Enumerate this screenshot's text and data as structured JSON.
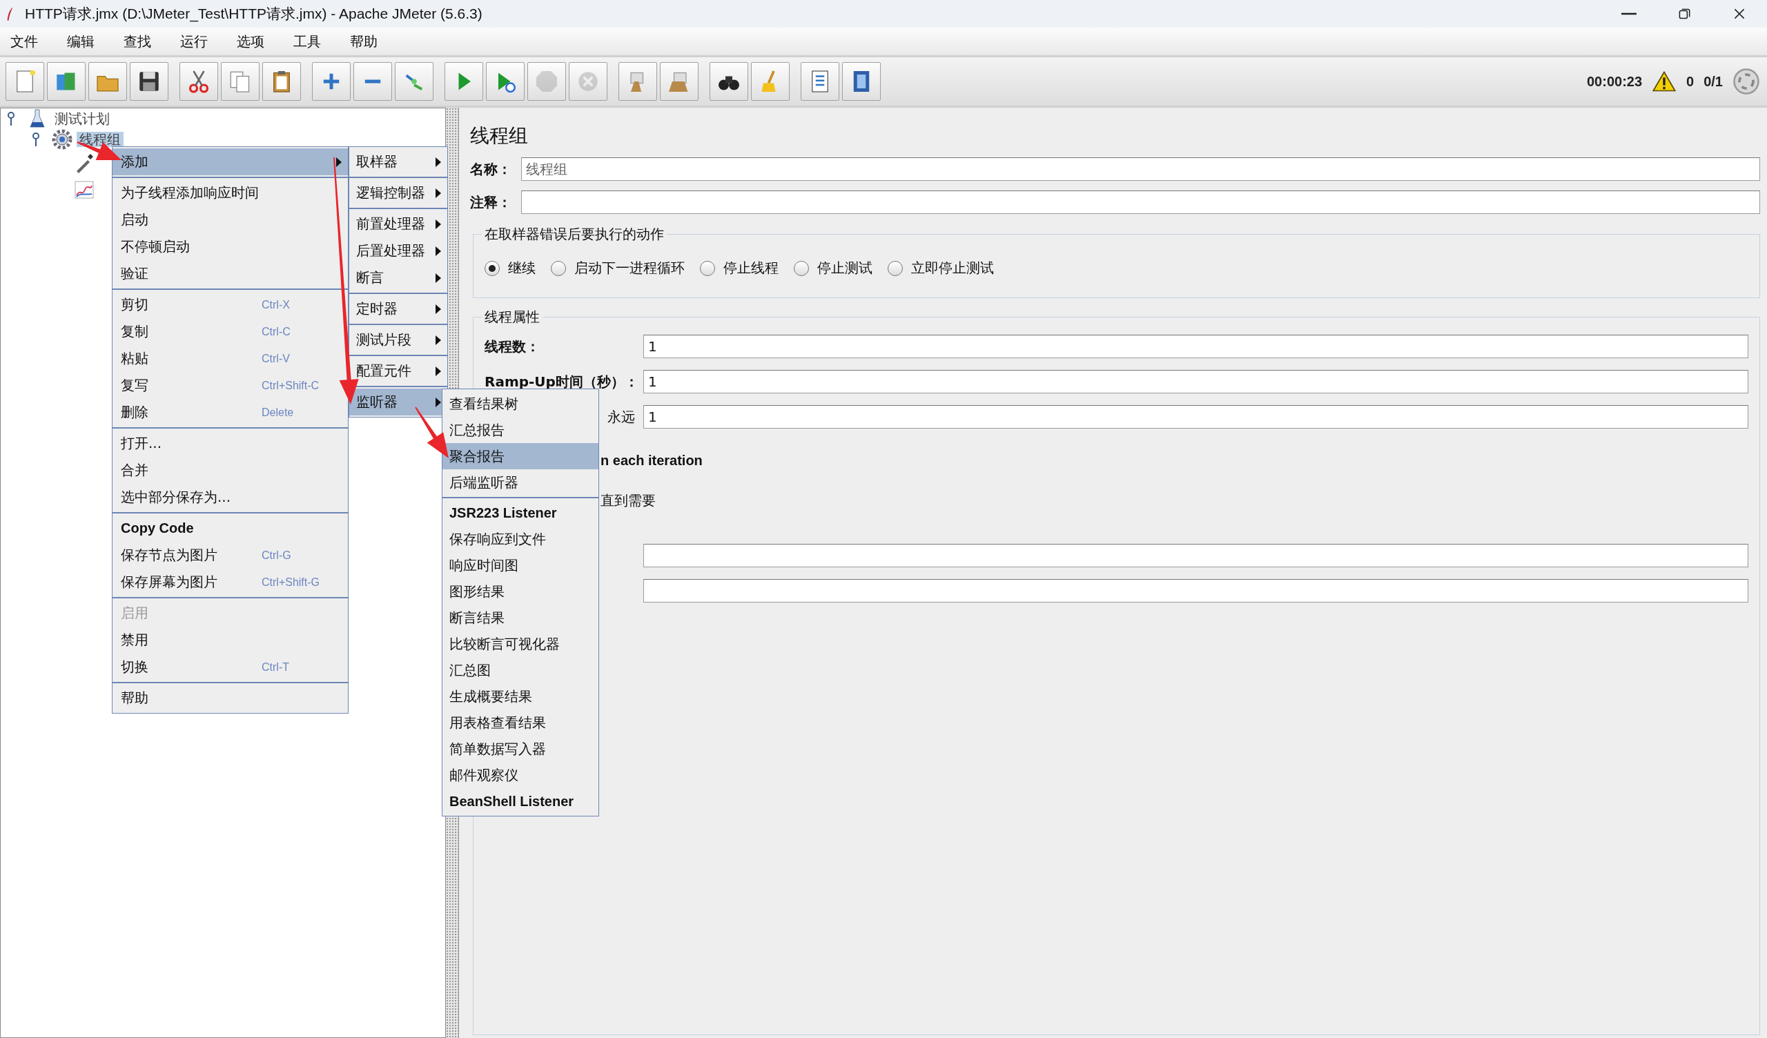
{
  "window": {
    "title": "HTTP请求.jmx (D:\\JMeter_Test\\HTTP请求.jmx) - Apache JMeter (5.6.3)"
  },
  "menu_bar": [
    "文件",
    "编辑",
    "查找",
    "运行",
    "选项",
    "工具",
    "帮助"
  ],
  "toolbar": {
    "groups": [
      [
        {
          "kind": "new",
          "disabled": false
        },
        {
          "kind": "templates",
          "disabled": false
        },
        {
          "kind": "open",
          "disabled": false
        },
        {
          "kind": "save",
          "disabled": false
        }
      ],
      [
        {
          "kind": "cut",
          "disabled": false
        },
        {
          "kind": "copy",
          "disabled": false
        },
        {
          "kind": "paste",
          "disabled": false
        }
      ],
      [
        {
          "kind": "expand",
          "disabled": false
        },
        {
          "kind": "collapse",
          "disabled": false
        },
        {
          "kind": "toggle",
          "disabled": false
        }
      ],
      [
        {
          "kind": "start",
          "disabled": false
        },
        {
          "kind": "start_no_pause",
          "disabled": false
        },
        {
          "kind": "stop",
          "disabled": true
        },
        {
          "kind": "shutdown",
          "disabled": true
        }
      ],
      [
        {
          "kind": "clear",
          "disabled": false
        },
        {
          "kind": "clear_all",
          "disabled": false
        }
      ],
      [
        {
          "kind": "search",
          "disabled": false
        },
        {
          "kind": "reset_search",
          "disabled": false
        }
      ],
      [
        {
          "kind": "function_helper",
          "disabled": false
        },
        {
          "kind": "help",
          "disabled": false
        }
      ]
    ],
    "elapsed_time": "00:00:23",
    "warning_count": "0",
    "active_threads": "0/1"
  },
  "tree": [
    {
      "label": "测试计划",
      "selected": false,
      "expanded": true,
      "children": [
        {
          "label": "线程组",
          "selected": true,
          "expanded": true,
          "children": [
            {
              "kind": "sampler"
            },
            {
              "kind": "listener"
            }
          ]
        }
      ]
    }
  ],
  "editor": {
    "title": "线程组",
    "name_label": "名称：",
    "name_value": "线程组",
    "comment_label": "注释：",
    "error_action": {
      "title": "在取样器错误后要执行的动作",
      "options": [
        {
          "label": "继续",
          "selected": true
        },
        {
          "label": "启动下一进程循环",
          "selected": false
        },
        {
          "label": "停止线程",
          "selected": false
        },
        {
          "label": "停止测试",
          "selected": false
        },
        {
          "label": "立即停止测试",
          "selected": false
        }
      ]
    },
    "thread_properties": {
      "title": "线程属性",
      "rows": [
        {
          "kind": "field",
          "label": "线程数：",
          "value": "1"
        },
        {
          "kind": "field",
          "label": "Ramp-Up时间（秒）：",
          "value": "1"
        },
        {
          "kind": "loop_field",
          "label": "永远",
          "value": "1"
        },
        {
          "kind": "note_bold",
          "label": "n each iteration"
        },
        {
          "kind": "note",
          "label": "直到需要"
        },
        {
          "kind": "field"
        },
        {
          "kind": "field"
        }
      ]
    }
  },
  "context_menu": {
    "groups": [
      [
        {
          "kind": "item",
          "label": "添加",
          "submenu": true,
          "selected": true,
          "disabled": false
        }
      ],
      [
        {
          "kind": "item",
          "label": "为子线程添加响应时间",
          "submenu": false,
          "selected": false,
          "disabled": false
        },
        {
          "kind": "item",
          "label": "启动",
          "submenu": false,
          "selected": false,
          "disabled": false
        },
        {
          "kind": "item",
          "label": "不停顿启动",
          "submenu": false,
          "selected": false,
          "disabled": false
        },
        {
          "kind": "item",
          "label": "验证",
          "submenu": false,
          "selected": false,
          "disabled": false
        }
      ],
      [
        {
          "kind": "item",
          "label": "剪切",
          "shortcut": "Ctrl-X",
          "submenu": false,
          "selected": false,
          "disabled": false
        },
        {
          "kind": "item",
          "label": "复制",
          "shortcut": "Ctrl-C",
          "submenu": false,
          "selected": false,
          "disabled": false
        },
        {
          "kind": "item",
          "label": "粘贴",
          "shortcut": "Ctrl-V",
          "submenu": false,
          "selected": false,
          "disabled": false
        },
        {
          "kind": "item",
          "label": "复写",
          "shortcut": "Ctrl+Shift-C",
          "submenu": false,
          "selected": false,
          "disabled": false
        },
        {
          "kind": "item",
          "label": "删除",
          "shortcut": "Delete",
          "submenu": false,
          "selected": false,
          "disabled": false
        }
      ],
      [
        {
          "kind": "item",
          "label": "打开...",
          "submenu": false,
          "selected": false,
          "disabled": false
        },
        {
          "kind": "item",
          "label": "合并",
          "submenu": false,
          "selected": false,
          "disabled": false
        },
        {
          "kind": "item",
          "label": "选中部分保存为...",
          "submenu": false,
          "selected": false,
          "disabled": false
        }
      ],
      [
        {
          "kind": "plugin",
          "label": "Copy Code",
          "submenu": false,
          "selected": false,
          "disabled": false
        },
        {
          "kind": "item",
          "label": "保存节点为图片",
          "shortcut": "Ctrl-G",
          "submenu": false,
          "selected": false,
          "disabled": false
        },
        {
          "kind": "item",
          "label": "保存屏幕为图片",
          "shortcut": "Ctrl+Shift-G",
          "submenu": false,
          "selected": false,
          "disabled": false
        }
      ],
      [
        {
          "kind": "item",
          "label": "启用",
          "submenu": false,
          "selected": false,
          "disabled": true
        },
        {
          "kind": "item",
          "label": "禁用",
          "submenu": false,
          "selected": false,
          "disabled": false
        },
        {
          "kind": "item",
          "label": "切换",
          "shortcut": "Ctrl-T",
          "submenu": false,
          "selected": false,
          "disabled": false
        }
      ],
      [
        {
          "kind": "item",
          "label": "帮助",
          "submenu": false,
          "selected": false,
          "disabled": false
        }
      ]
    ]
  },
  "add_submenu": {
    "groups": [
      [
        {
          "label": "取样器",
          "selected": false
        }
      ],
      [
        {
          "label": "逻辑控制器",
          "selected": false
        }
      ],
      [
        {
          "label": "前置处理器",
          "selected": false
        },
        {
          "label": "后置处理器",
          "selected": false
        },
        {
          "label": "断言",
          "selected": false
        }
      ],
      [
        {
          "label": "定时器",
          "selected": false
        }
      ],
      [
        {
          "label": "测试片段",
          "selected": false
        }
      ],
      [
        {
          "label": "配置元件",
          "selected": false
        }
      ],
      [
        {
          "label": "监听器",
          "selected": true
        }
      ]
    ]
  },
  "listener_submenu": {
    "groups": [
      [
        {
          "kind": "item",
          "label": "查看结果树",
          "selected": false
        },
        {
          "kind": "item",
          "label": "汇总报告",
          "selected": false
        },
        {
          "kind": "item",
          "label": "聚合报告",
          "selected": true
        },
        {
          "kind": "item",
          "label": "后端监听器",
          "selected": false
        }
      ],
      [
        {
          "kind": "plugin",
          "label": "JSR223 Listener",
          "selected": false
        },
        {
          "kind": "item",
          "label": "保存响应到文件",
          "selected": false
        },
        {
          "kind": "item",
          "label": "响应时间图",
          "selected": false
        },
        {
          "kind": "item",
          "label": "图形结果",
          "selected": false
        },
        {
          "kind": "item",
          "label": "断言结果",
          "selected": false
        },
        {
          "kind": "item",
          "label": "比较断言可视化器",
          "selected": false
        },
        {
          "kind": "item",
          "label": "汇总图",
          "selected": false
        },
        {
          "kind": "item",
          "label": "生成概要结果",
          "selected": false
        },
        {
          "kind": "item",
          "label": "用表格查看结果",
          "selected": false
        },
        {
          "kind": "item",
          "label": "简单数据写入器",
          "selected": false
        },
        {
          "kind": "item",
          "label": "邮件观察仪",
          "selected": false
        },
        {
          "kind": "plugin",
          "label": "BeanShell Listener",
          "selected": false
        }
      ]
    ]
  },
  "annotations": [
    {
      "kind": "arrow"
    },
    {
      "kind": "arrow"
    },
    {
      "kind": "arrow"
    }
  ]
}
